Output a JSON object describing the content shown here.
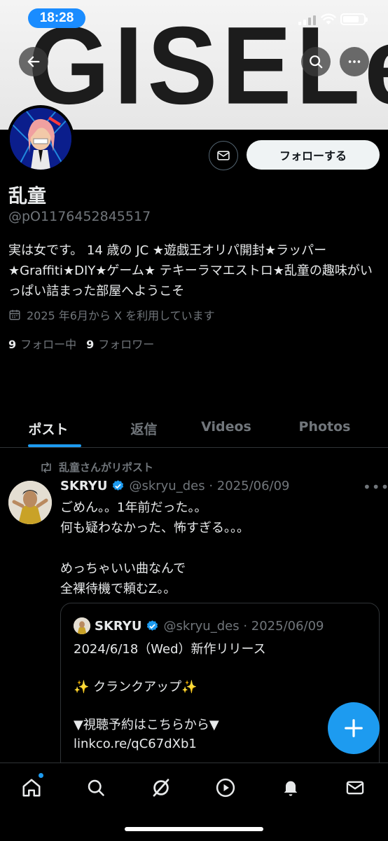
{
  "status_bar": {
    "time": "18:28"
  },
  "banner": {
    "logo_text": "GISELe"
  },
  "header": {
    "back_icon": "arrow-left-icon",
    "search_icon": "search-icon",
    "more_icon": "more-horizontal-icon"
  },
  "profile": {
    "name": "乱童",
    "handle": "@pO1176452845517",
    "bio": "実は女です。 14 歳の JC ★遊戯王オリパ開封★ラッパー★Graffiti★DIY★ゲーム★ テキーラマエストロ★乱童の趣味がいっぱい詰まった部屋へようこそ",
    "joined": "2025 年6月から X を利用しています",
    "following_count": "9",
    "following_label": "フォロー中",
    "followers_count": "9",
    "followers_label": "フォロワー",
    "follow_button": "フォローする"
  },
  "tabs": [
    {
      "label": "ポスト",
      "active": true
    },
    {
      "label": "返信",
      "active": false
    },
    {
      "label": "Videos",
      "active": false
    },
    {
      "label": "Photos",
      "active": false
    }
  ],
  "post": {
    "repost_label": "乱童さんがリポスト",
    "author_name": "SKRYU",
    "author_handle_date": "@skryu_des · 2025/06/09",
    "text": "ごめん。。1年前だった。。\n何も疑わなかった、怖すぎる。。。\n\nめっちゃいい曲なんで\n全裸待機で頼むZ。。",
    "quote": {
      "author_name": "SKRYU",
      "author_handle_date": "@skryu_des · 2025/06/09",
      "text": "2024/6/18（Wed）新作リリース\n\n✨ クランクアップ✨\n\n▼視聴予約はこちらから▼\nlinkco.re/qC67dXb1"
    }
  },
  "colors": {
    "accent": "#1d9bf0",
    "background": "#000000",
    "secondary_text": "#71767b",
    "border": "#2f3336"
  },
  "bottom_nav": [
    "home-icon",
    "search-icon",
    "grok-icon",
    "play-circle-icon",
    "bell-icon",
    "mail-icon"
  ]
}
